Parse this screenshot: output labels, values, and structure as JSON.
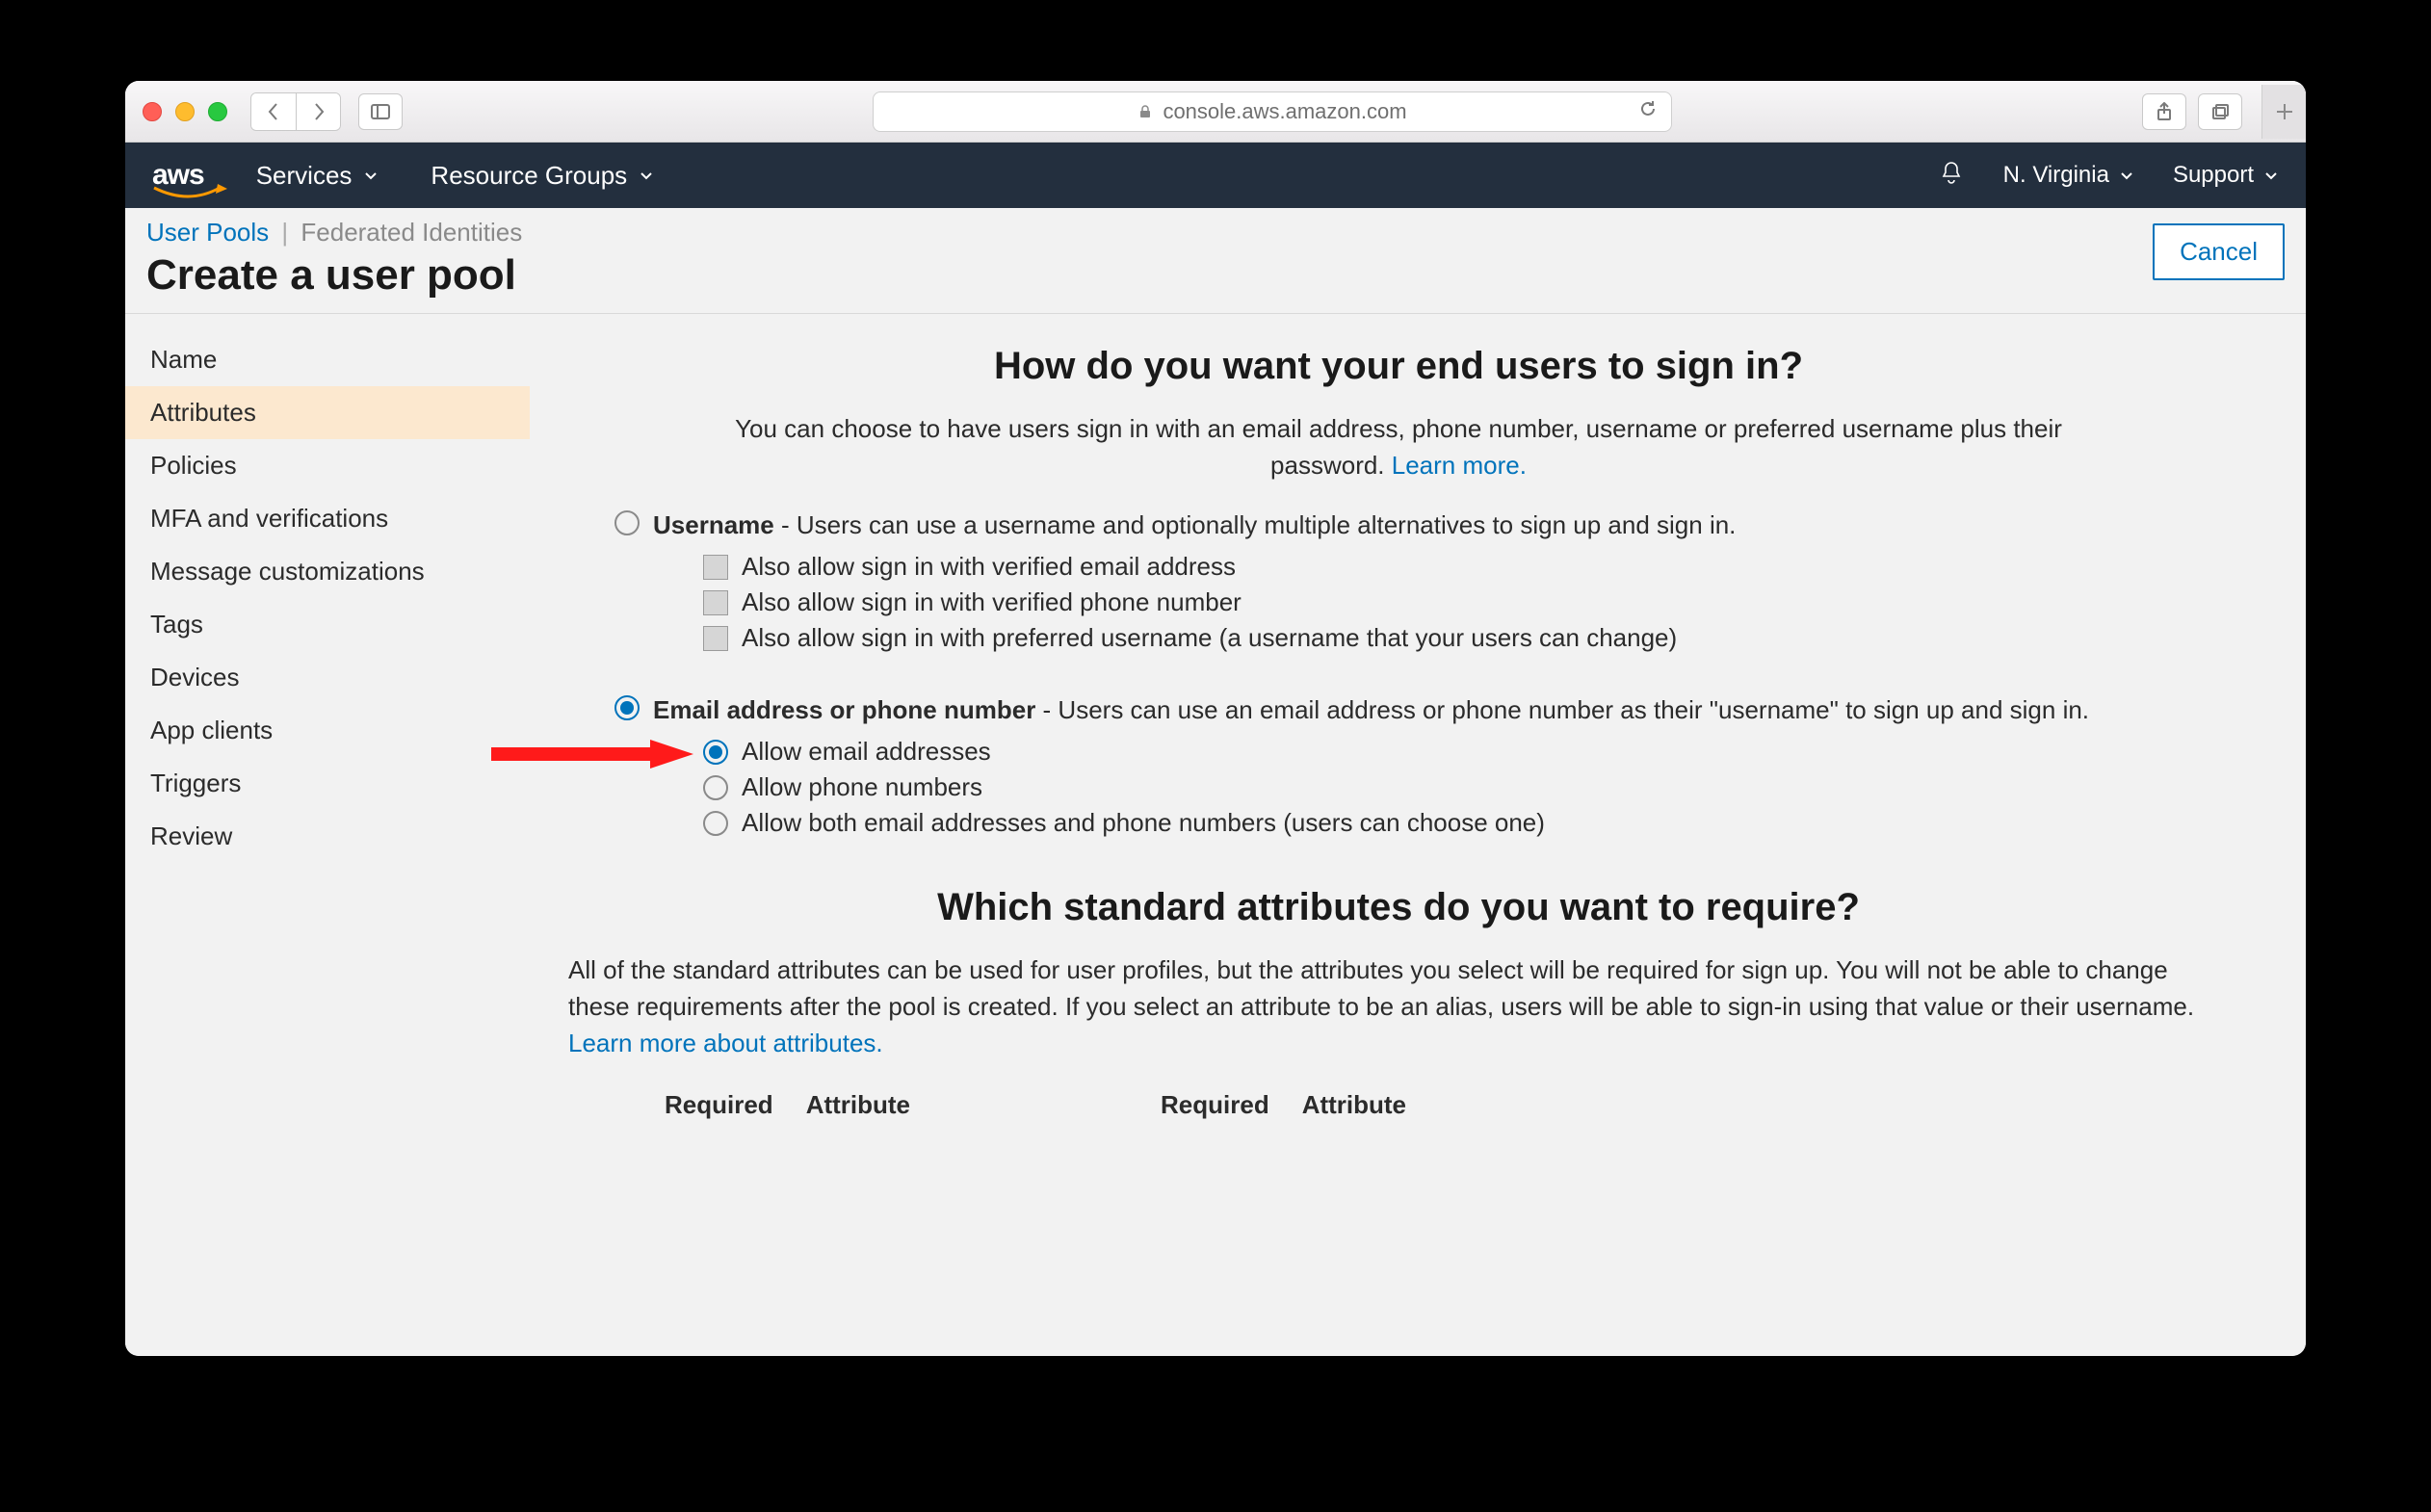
{
  "browser": {
    "address": "console.aws.amazon.com"
  },
  "awsNav": {
    "logo": "aws",
    "services": "Services",
    "resourceGroups": "Resource Groups",
    "region": "N. Virginia",
    "support": "Support"
  },
  "breadcrumb": {
    "userPools": "User Pools",
    "federated": "Federated Identities",
    "title": "Create a user pool",
    "cancel": "Cancel"
  },
  "sidebar": {
    "items": [
      "Name",
      "Attributes",
      "Policies",
      "MFA and verifications",
      "Message customizations",
      "Tags",
      "Devices",
      "App clients",
      "Triggers",
      "Review"
    ],
    "activeIndex": 1
  },
  "section1": {
    "heading": "How do you want your end users to sign in?",
    "intro": "You can choose to have users sign in with an email address, phone number, username or preferred username plus their password. ",
    "learnMore": "Learn more.",
    "opt1_bold": "Username",
    "opt1_rest": " - Users can use a username and optionally multiple alternatives to sign up and sign in.",
    "opt1_sub": [
      "Also allow sign in with verified email address",
      "Also allow sign in with verified phone number",
      "Also allow sign in with preferred username (a username that your users can change)"
    ],
    "opt2_bold": "Email address or phone number",
    "opt2_rest": " - Users can use an email address or phone number as their \"username\" to sign up and sign in.",
    "opt2_sub": [
      "Allow email addresses",
      "Allow phone numbers",
      "Allow both email addresses and phone numbers (users can choose one)"
    ]
  },
  "section2": {
    "heading": "Which standard attributes do you want to require?",
    "intro": "All of the standard attributes can be used for user profiles, but the attributes you select will be required for sign up. You will not be able to change these requirements after the pool is created. If you select an attribute to be an alias, users will be able to sign-in using that value or their username. ",
    "learnMore": "Learn more about attributes.",
    "colRequired": "Required",
    "colAttribute": "Attribute"
  }
}
